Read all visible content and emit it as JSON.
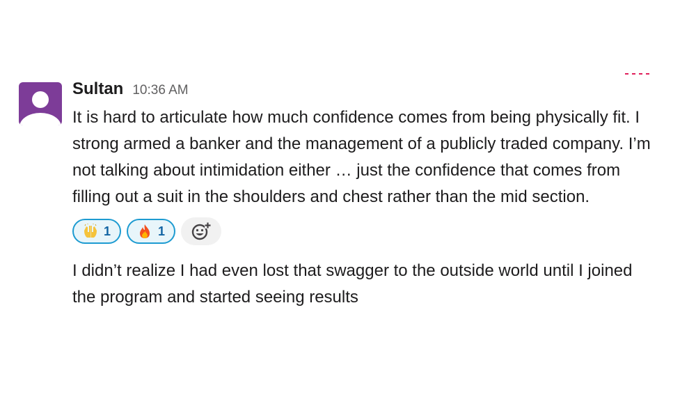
{
  "message": {
    "author": "Sultan",
    "timestamp": "10:36 AM",
    "paragraphs": [
      "It is hard to articulate how much confidence comes from being physically fit. I strong armed a banker and the management of a publicly traded company. I’m not talking about intimidation either … just the confidence that comes from filling out a suit in the shoulders and chest rather than the mid section.",
      "I didn’t realize I had even lost that swagger to the outside world until I joined the program and started seeing results"
    ],
    "reactions": [
      {
        "icon": "raised-hands-icon",
        "count": "1"
      },
      {
        "icon": "fire-icon",
        "count": "1"
      }
    ]
  },
  "colors": {
    "avatar": "#7d3c98",
    "reaction_border": "#1d9bd1",
    "reaction_bg": "#e8f5fa",
    "new_marker": "#e01e5a"
  }
}
